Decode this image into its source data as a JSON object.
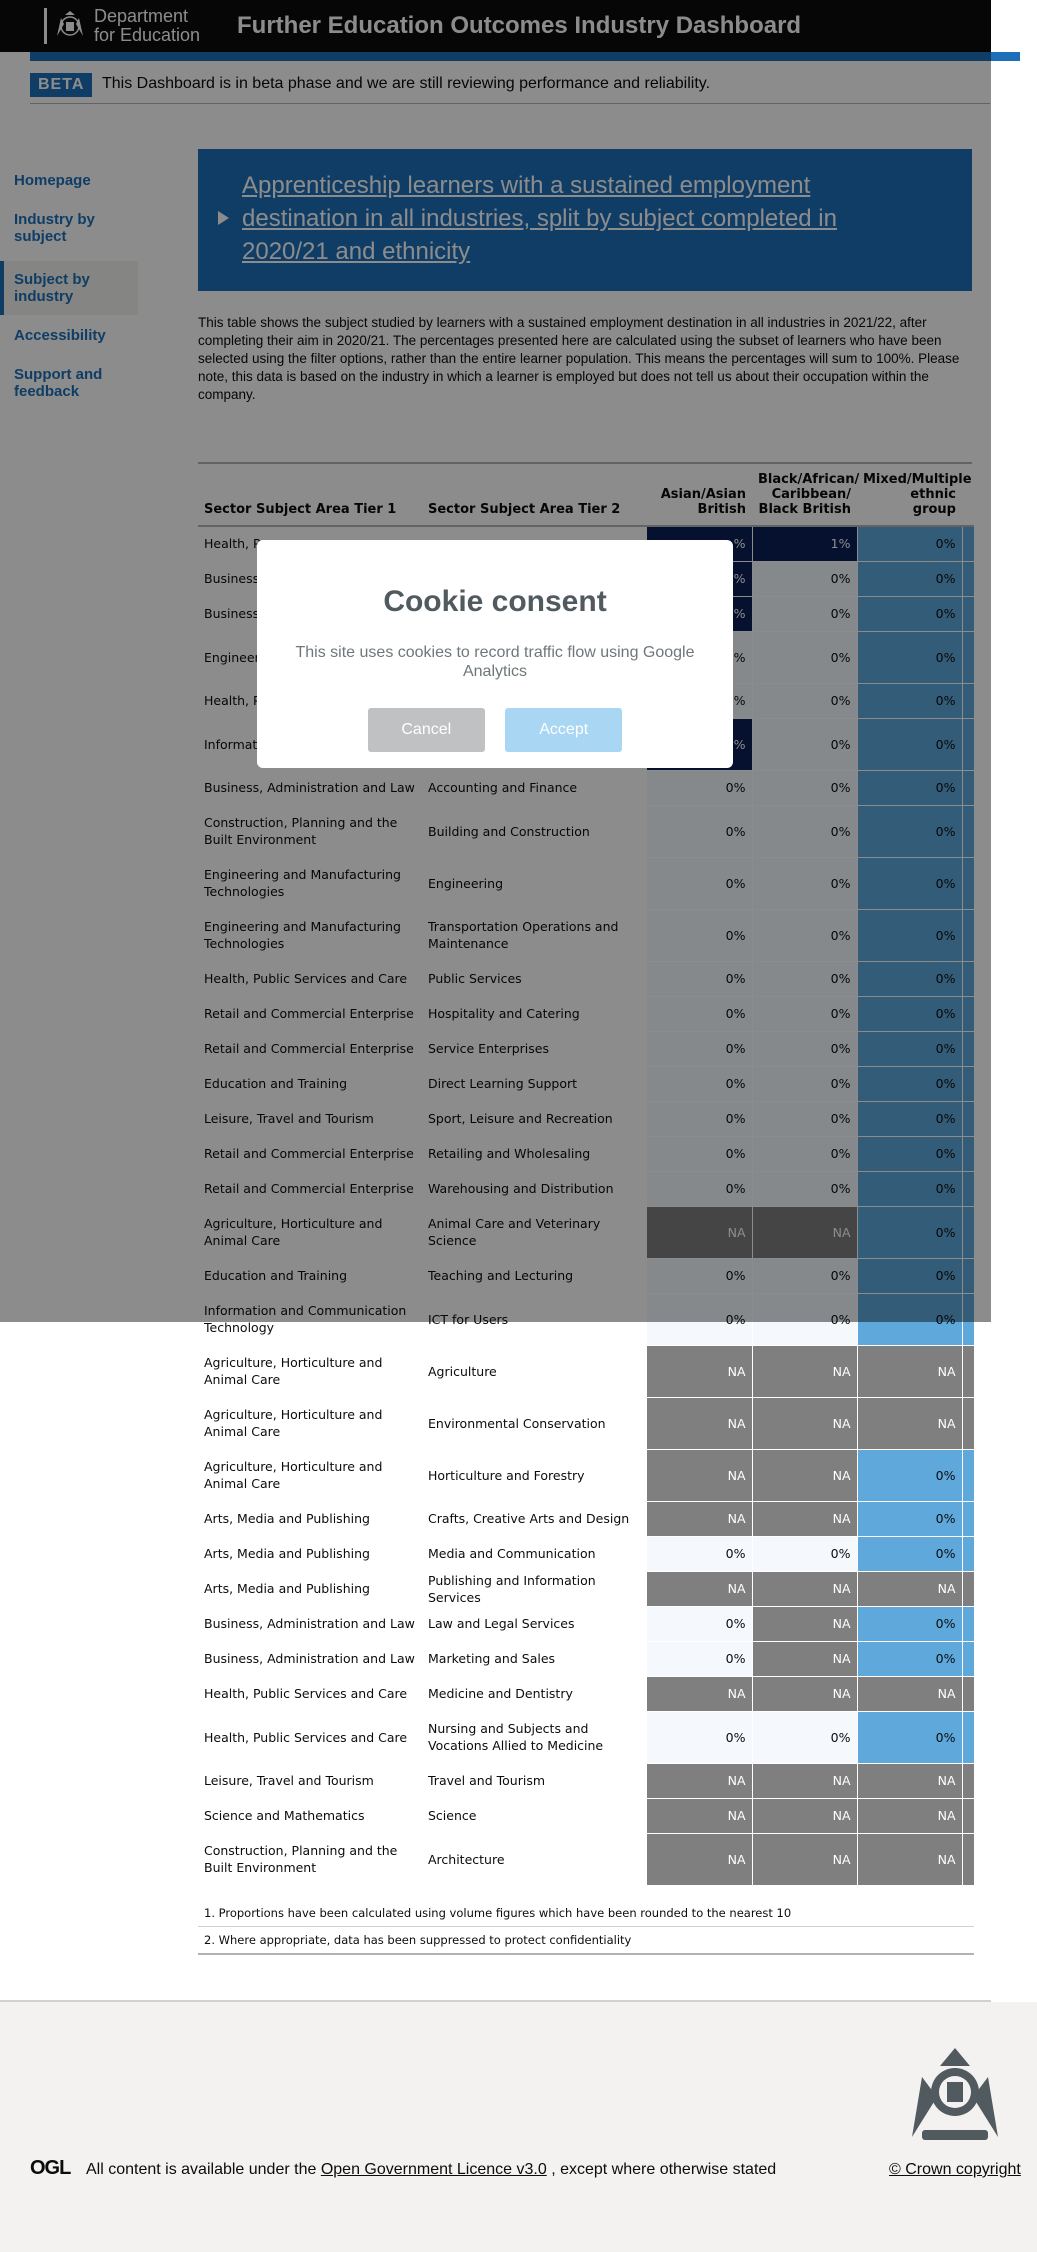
{
  "header": {
    "dept_line1": "Department",
    "dept_line2": "for Education",
    "title": "Further Education Outcomes Industry Dashboard"
  },
  "beta": {
    "tag": "BETA",
    "message": "This Dashboard is in beta phase and we are still reviewing performance and reliability."
  },
  "nav": {
    "items": [
      {
        "label": "Homepage"
      },
      {
        "label": "Industry by subject"
      },
      {
        "label": "Subject by industry",
        "active": true
      },
      {
        "label": "Accessibility"
      },
      {
        "label": "Support and feedback"
      }
    ]
  },
  "details": {
    "summary": "Apprenticeship learners with a sustained employment destination in all industries, split by subject completed in 2020/21 and ethnicity"
  },
  "description": "This table shows the subject studied by learners with a sustained employment destination in all industries in 2021/22, after completing their aim in 2020/21. The percentages presented here are calculated using the subset of learners who have been selected using the filter options, rather than the entire learner population. This means the percentages will sum to 100%. Please note, this data is based on the industry in which a learner is employed but does not tell us about their occupation within the company.",
  "table": {
    "headers": [
      "Sector Subject Area Tier 1",
      "Sector Subject Area Tier 2",
      "Asian/Asian British",
      "Black/African/ Caribbean/ Black British",
      "Mixed/Multiple ethnic group"
    ],
    "rows": [
      {
        "t1": "Health, P",
        "t2": "",
        "v": [
          "%",
          "1%",
          "0%"
        ],
        "c": [
          "c-dark",
          "c-dark",
          "c-low"
        ]
      },
      {
        "t1": "Business,",
        "t2": "",
        "v": [
          "%",
          "0%",
          "0%"
        ],
        "c": [
          "c-dark",
          "c-z",
          "c-low"
        ]
      },
      {
        "t1": "Business,",
        "t2": "",
        "v": [
          "%",
          "0%",
          "0%"
        ],
        "c": [
          "c-dark",
          "c-z",
          "c-low"
        ]
      },
      {
        "t1": "Engineer Technolo",
        "t2": "",
        "v": [
          "%",
          "0%",
          "0%"
        ],
        "c": [
          "c-z",
          "c-z",
          "c-low"
        ]
      },
      {
        "t1": "Health, P",
        "t2": "",
        "v": [
          "%",
          "0%",
          "0%"
        ],
        "c": [
          "c-z",
          "c-z",
          "c-low"
        ]
      },
      {
        "t1": "Informati Technolo",
        "t2": "",
        "v": [
          "%",
          "0%",
          "0%"
        ],
        "c": [
          "c-dark",
          "c-z",
          "c-low"
        ]
      },
      {
        "t1": "Business, Administration and Law",
        "t2": "Accounting and Finance",
        "v": [
          "0%",
          "0%",
          "0%"
        ],
        "c": [
          "c-z",
          "c-z",
          "c-low"
        ]
      },
      {
        "t1": "Construction, Planning and the Built Environment",
        "t2": "Building and Construction",
        "v": [
          "0%",
          "0%",
          "0%"
        ],
        "c": [
          "c-z",
          "c-z",
          "c-low"
        ]
      },
      {
        "t1": "Engineering and Manufacturing Technologies",
        "t2": "Engineering",
        "v": [
          "0%",
          "0%",
          "0%"
        ],
        "c": [
          "c-z",
          "c-z",
          "c-low"
        ]
      },
      {
        "t1": "Engineering and Manufacturing Technologies",
        "t2": "Transportation Operations and Maintenance",
        "v": [
          "0%",
          "0%",
          "0%"
        ],
        "c": [
          "c-z",
          "c-z",
          "c-low"
        ]
      },
      {
        "t1": "Health, Public Services and Care",
        "t2": "Public Services",
        "v": [
          "0%",
          "0%",
          "0%"
        ],
        "c": [
          "c-z",
          "c-z",
          "c-low"
        ]
      },
      {
        "t1": "Retail and Commercial Enterprise",
        "t2": "Hospitality and Catering",
        "v": [
          "0%",
          "0%",
          "0%"
        ],
        "c": [
          "c-z",
          "c-z",
          "c-low"
        ]
      },
      {
        "t1": "Retail and Commercial Enterprise",
        "t2": "Service Enterprises",
        "v": [
          "0%",
          "0%",
          "0%"
        ],
        "c": [
          "c-z",
          "c-z",
          "c-low"
        ]
      },
      {
        "t1": "Education and Training",
        "t2": "Direct Learning Support",
        "v": [
          "0%",
          "0%",
          "0%"
        ],
        "c": [
          "c-z",
          "c-z",
          "c-low"
        ]
      },
      {
        "t1": "Leisure, Travel and Tourism",
        "t2": "Sport, Leisure and Recreation",
        "v": [
          "0%",
          "0%",
          "0%"
        ],
        "c": [
          "c-z",
          "c-z",
          "c-low"
        ]
      },
      {
        "t1": "Retail and Commercial Enterprise",
        "t2": "Retailing and Wholesaling",
        "v": [
          "0%",
          "0%",
          "0%"
        ],
        "c": [
          "c-z",
          "c-z",
          "c-low"
        ]
      },
      {
        "t1": "Retail and Commercial Enterprise",
        "t2": "Warehousing and Distribution",
        "v": [
          "0%",
          "0%",
          "0%"
        ],
        "c": [
          "c-z",
          "c-z",
          "c-low"
        ]
      },
      {
        "t1": "Agriculture, Horticulture and Animal Care",
        "t2": "Animal Care and Veterinary Science",
        "v": [
          "NA",
          "NA",
          "0%"
        ],
        "c": [
          "c-na",
          "c-na",
          "c-low"
        ]
      },
      {
        "t1": "Education and Training",
        "t2": "Teaching and Lecturing",
        "v": [
          "0%",
          "0%",
          "0%"
        ],
        "c": [
          "c-z",
          "c-z",
          "c-low"
        ]
      },
      {
        "t1": "Information and Communication Technology",
        "t2": "ICT for Users",
        "v": [
          "0%",
          "0%",
          "0%"
        ],
        "c": [
          "c-z",
          "c-z",
          "c-low"
        ]
      },
      {
        "t1": "Agriculture, Horticulture and Animal Care",
        "t2": "Agriculture",
        "v": [
          "NA",
          "NA",
          "NA"
        ],
        "c": [
          "c-na",
          "c-na",
          "c-na"
        ]
      },
      {
        "t1": "Agriculture, Horticulture and Animal Care",
        "t2": "Environmental Conservation",
        "v": [
          "NA",
          "NA",
          "NA"
        ],
        "c": [
          "c-na",
          "c-na",
          "c-na"
        ]
      },
      {
        "t1": "Agriculture, Horticulture and Animal Care",
        "t2": "Horticulture and Forestry",
        "v": [
          "NA",
          "NA",
          "0%"
        ],
        "c": [
          "c-na",
          "c-na",
          "c-low"
        ]
      },
      {
        "t1": "Arts, Media and Publishing",
        "t2": "Crafts, Creative Arts and Design",
        "v": [
          "NA",
          "NA",
          "0%"
        ],
        "c": [
          "c-na",
          "c-na",
          "c-low"
        ]
      },
      {
        "t1": "Arts, Media and Publishing",
        "t2": "Media and Communication",
        "v": [
          "0%",
          "0%",
          "0%"
        ],
        "c": [
          "c-z",
          "c-z",
          "c-low"
        ]
      },
      {
        "t1": "Arts, Media and Publishing",
        "t2": "Publishing and Information Services",
        "v": [
          "NA",
          "NA",
          "NA"
        ],
        "c": [
          "c-na",
          "c-na",
          "c-na"
        ]
      },
      {
        "t1": "Business, Administration and Law",
        "t2": "Law and Legal Services",
        "v": [
          "0%",
          "NA",
          "0%"
        ],
        "c": [
          "c-z",
          "c-na",
          "c-low"
        ]
      },
      {
        "t1": "Business, Administration and Law",
        "t2": "Marketing and Sales",
        "v": [
          "0%",
          "NA",
          "0%"
        ],
        "c": [
          "c-z",
          "c-na",
          "c-low"
        ]
      },
      {
        "t1": "Health, Public Services and Care",
        "t2": "Medicine and Dentistry",
        "v": [
          "NA",
          "NA",
          "NA"
        ],
        "c": [
          "c-na",
          "c-na",
          "c-na"
        ]
      },
      {
        "t1": "Health, Public Services and Care",
        "t2": "Nursing and Subjects and Vocations Allied to Medicine",
        "v": [
          "0%",
          "0%",
          "0%"
        ],
        "c": [
          "c-z",
          "c-z",
          "c-low"
        ]
      },
      {
        "t1": "Leisure, Travel and Tourism",
        "t2": "Travel and Tourism",
        "v": [
          "NA",
          "NA",
          "NA"
        ],
        "c": [
          "c-na",
          "c-na",
          "c-na"
        ]
      },
      {
        "t1": "Science and Mathematics",
        "t2": "Science",
        "v": [
          "NA",
          "NA",
          "NA"
        ],
        "c": [
          "c-na",
          "c-na",
          "c-na"
        ]
      },
      {
        "t1": "Construction, Planning and the Built Environment",
        "t2": "Architecture",
        "v": [
          "NA",
          "NA",
          "NA"
        ],
        "c": [
          "c-na",
          "c-na",
          "c-na"
        ]
      }
    ]
  },
  "notes": [
    "1. Proportions have been calculated using volume figures which have been rounded to the nearest 10",
    "2. Where appropriate, data has been suppressed to protect confidentiality"
  ],
  "footer": {
    "ogl": "OGL",
    "licence_prefix": "All content is available under the",
    "licence_link": "Open Government Licence v3.0",
    "licence_suffix": ", except where otherwise stated",
    "copyright": "© Crown copyright"
  },
  "cookie": {
    "title": "Cookie consent",
    "message": "This site uses cookies to record traffic flow using Google Analytics",
    "cancel": "Cancel",
    "accept": "Accept"
  },
  "colors": {
    "brand_blue": "#1d70b8",
    "header_black": "#0b0c0c",
    "na_grey": "#7f7f7f",
    "mixed_blue": "#5ea8dc",
    "dark_navy": "#0b1f57"
  }
}
